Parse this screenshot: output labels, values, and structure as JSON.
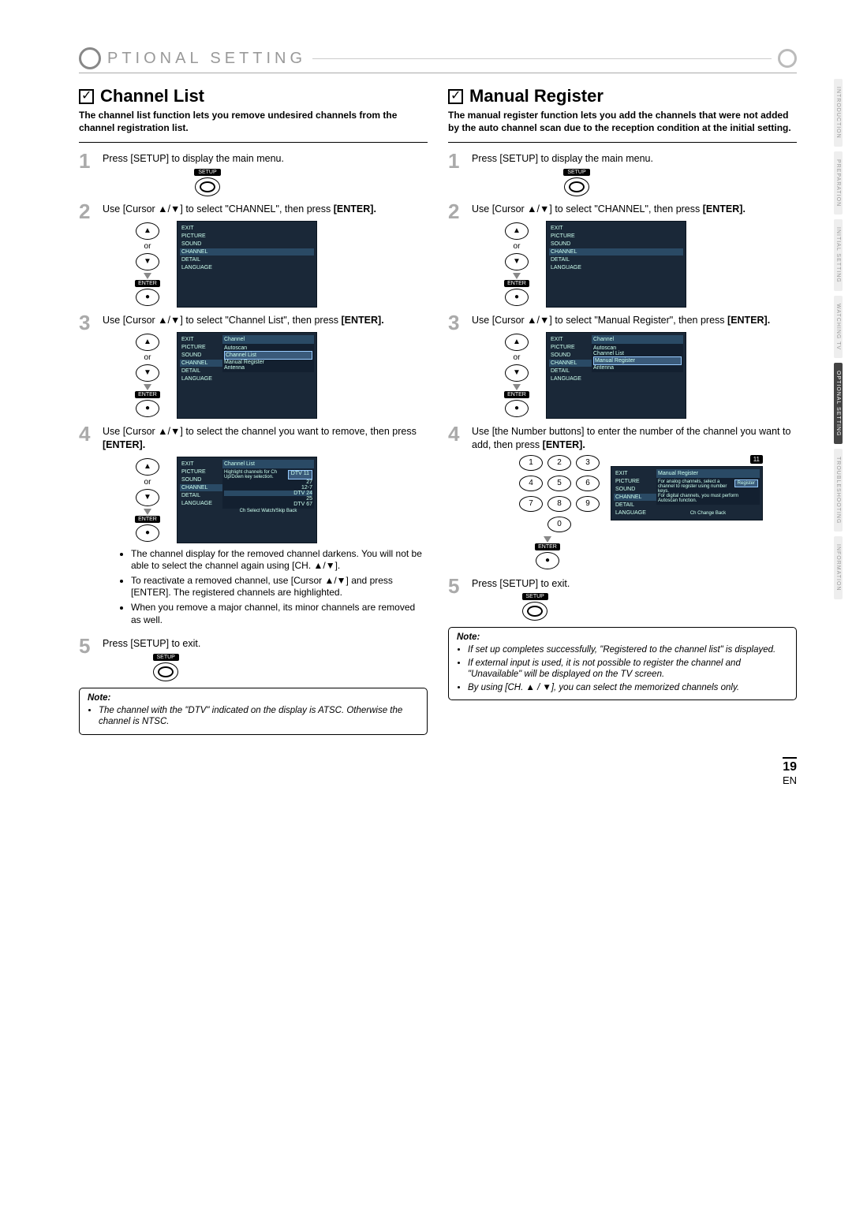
{
  "header": {
    "title": "PTIONAL SETTING"
  },
  "tabs": [
    "INTRODUCTION",
    "PREPARATION",
    "INITIAL SETTING",
    "WATCHING TV",
    "OPTIONAL SETTING",
    "TROUBLESHOOTING",
    "INFORMATION"
  ],
  "page": {
    "num": "19",
    "lang": "EN"
  },
  "channelList": {
    "title": "Channel List",
    "intro": "The channel list function lets you remove undesired channels from the channel registration list.",
    "s1": "Press [SETUP] to display the main menu.",
    "s2a": "Use [Cursor ▲/▼] to select \"CHANNEL\", then press ",
    "s2b": "[ENTER].",
    "s3a": "Use [Cursor ▲/▼] to select \"Channel List\", then press ",
    "s3b": "[ENTER].",
    "s4a": "Use [Cursor ▲/▼] to select the channel you want to remove, then press ",
    "s4b": "[ENTER].",
    "bul1": "The channel display for the removed channel darkens. You will not be able to select the channel again using [CH. ▲/▼].",
    "bul2": "To reactivate a removed channel, use [Cursor ▲/▼] and press [ENTER]. The registered channels are highlighted.",
    "bul3": "When you remove a major channel, its minor channels are removed as well.",
    "s5": "Press [SETUP] to exit.",
    "note1": "The channel with the \"DTV\" indicated on the display is ATSC. Otherwise the channel is NTSC."
  },
  "manualRegister": {
    "title": "Manual Register",
    "intro": "The manual register function lets you add the channels that were not added by the auto channel scan due to the reception condition at the initial setting.",
    "s1": "Press [SETUP] to display the main menu.",
    "s2a": "Use [Cursor ▲/▼] to select \"CHANNEL\", then press ",
    "s2b": "[ENTER].",
    "s3a": "Use [Cursor ▲/▼] to select \"Manual Register\", then press ",
    "s3b": "[ENTER].",
    "s4a": "Use [the Number buttons] to enter the number of the channel you want to add, then press ",
    "s4b": "[ENTER].",
    "s5": "Press [SETUP] to exit.",
    "badge": "11",
    "note1": "If set up completes successfully, \"Registered to the channel list\" is displayed.",
    "note2": "If external input is used, it is not possible to register the channel and \"Unavailable\" will be displayed on the TV screen.",
    "note3": "By using [CH. ▲ / ▼], you can select the memorized channels only."
  },
  "osd": {
    "menu": [
      "EXIT",
      "PICTURE",
      "SOUND",
      "CHANNEL",
      "DETAIL",
      "LANGUAGE"
    ],
    "channelMenu": {
      "hdr": "Channel",
      "items": [
        "Autoscan",
        "Channel List",
        "Manual Register",
        "Antenna"
      ]
    },
    "channelListScr": {
      "hdr": "Channel List",
      "hint": "Highlight channels for Ch Up/Down key selection.",
      "rows": [
        [
          "DTV",
          "11"
        ],
        [
          "",
          "27"
        ],
        [
          "",
          "12-7"
        ],
        [
          "DTV",
          "24"
        ],
        [
          "",
          "25"
        ],
        [
          "DTV",
          "67"
        ]
      ],
      "foot": "Ch Select    Watch/Skip    Back"
    },
    "manualRegScr": {
      "hdr": "Manual Register",
      "hint1": "For analog channels, select a channel to register using number keys.",
      "hint2": "For digital channels, you must perform Autoscan function.",
      "btn": "Register",
      "foot": "Ch Change    Back"
    }
  },
  "remote": {
    "setup": "SETUP",
    "enter": "ENTER",
    "or": "or"
  },
  "noteLabel": "Note:"
}
